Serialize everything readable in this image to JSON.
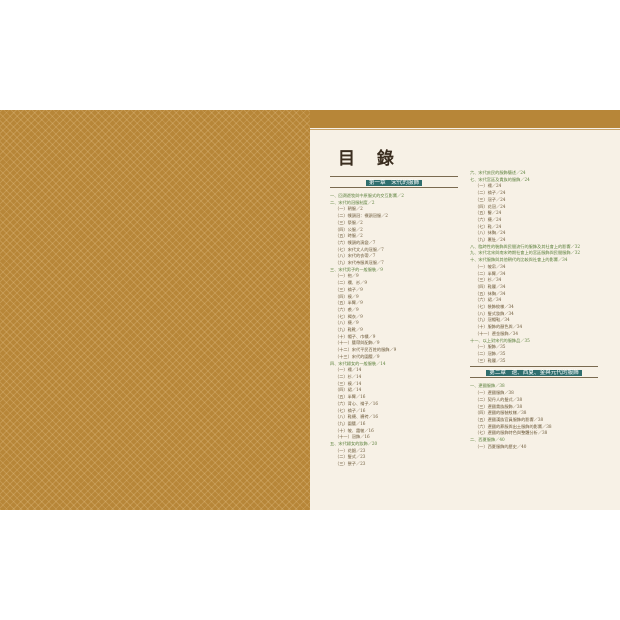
{
  "title": "目 錄",
  "left_column": [
    {
      "type": "chapter",
      "text": "第一章　宋代的服飾"
    },
    {
      "type": "l1",
      "text": "一、回溯遊牧與中原服式的交互影響／2"
    },
    {
      "type": "l1",
      "text": "二、宋代的冠服制度／2"
    },
    {
      "type": "l2",
      "text": "（一）朝服／2"
    },
    {
      "type": "l2",
      "text": "（二）幞頭冠：襆頭冠服／2"
    },
    {
      "type": "l2",
      "text": "（三）祭服／2"
    },
    {
      "type": "l2",
      "text": "（四）公服／2"
    },
    {
      "type": "l2",
      "text": "（五）時服／2"
    },
    {
      "type": "l2",
      "text": "（六）幞頭的演變／7"
    },
    {
      "type": "l2",
      "text": "（七）宋代文人的冠服／7"
    },
    {
      "type": "l2",
      "text": "（八）宋代的衣帶／7"
    },
    {
      "type": "l2",
      "text": "（九）宋代帝服與冠服／7"
    },
    {
      "type": "l1",
      "text": "三、宋代男子的一般服裝／9"
    },
    {
      "type": "l2",
      "text": "（一）袍／9"
    },
    {
      "type": "l2",
      "text": "（二）襴、衫／9"
    },
    {
      "type": "l2",
      "text": "（三）褙子／9"
    },
    {
      "type": "l2",
      "text": "（四）襖／9"
    },
    {
      "type": "l2",
      "text": "（五）半臂／9"
    },
    {
      "type": "l2",
      "text": "（六）裘／9"
    },
    {
      "type": "l2",
      "text": "（七）褐衣／9"
    },
    {
      "type": "l2",
      "text": "（八）襪／9"
    },
    {
      "type": "l2",
      "text": "（九）鞋靴／9"
    },
    {
      "type": "l2",
      "text": "（十）帽子、巾幘／9"
    },
    {
      "type": "l2",
      "text": "（十一）腰帶與配飾／9"
    },
    {
      "type": "l2",
      "text": "（十二）宋代平民百姓的服飾／9"
    },
    {
      "type": "l2",
      "text": "（十三）宋代的圍腰／9"
    },
    {
      "type": "l1",
      "text": "四、宋代婦女的一般服裝／14"
    },
    {
      "type": "l2",
      "text": "（一）襦／14"
    },
    {
      "type": "l2",
      "text": "（二）衫／14"
    },
    {
      "type": "l2",
      "text": "（三）襖／14"
    },
    {
      "type": "l2",
      "text": "（四）裙／14"
    },
    {
      "type": "l2",
      "text": "（五）半臂／16"
    },
    {
      "type": "l2",
      "text": "（六）背心、褙子／16"
    },
    {
      "type": "l2",
      "text": "（七）褙子／16"
    },
    {
      "type": "l2",
      "text": "（八）鞋襪、襪袴／16"
    },
    {
      "type": "l2",
      "text": "（九）圍腰／16"
    },
    {
      "type": "l2",
      "text": "（十）帔、霞帔／16"
    },
    {
      "type": "l2",
      "text": "（十一）冠飾／16"
    },
    {
      "type": "l1",
      "text": "五、宋代婦女的妝飾／20"
    },
    {
      "type": "l2",
      "text": "（一）花鈿／23"
    },
    {
      "type": "l2",
      "text": "（二）髮式／23"
    },
    {
      "type": "l2",
      "text": "（三）鬟子／23"
    }
  ],
  "right_column": [
    {
      "type": "l1",
      "text": "六、宋代庶民的服飾簡述／24"
    },
    {
      "type": "l1",
      "text": "七、宋代宮廷及貴族的服飾／24"
    },
    {
      "type": "l2",
      "text": "（一）襦／24"
    },
    {
      "type": "l2",
      "text": "（二）褙子／24"
    },
    {
      "type": "l2",
      "text": "（三）冠子／24"
    },
    {
      "type": "l2",
      "text": "（四）花冠／24"
    },
    {
      "type": "l2",
      "text": "（五）髻／24"
    },
    {
      "type": "l2",
      "text": "（六）襪／24"
    },
    {
      "type": "l2",
      "text": "（七）鞋／24"
    },
    {
      "type": "l2",
      "text": "（八）抹胸／24"
    },
    {
      "type": "l2",
      "text": "（九）裹肚／24"
    },
    {
      "type": "l1",
      "text": "八、臨時性的裝飾與民間流行的服飾及其社會上的影響／32"
    },
    {
      "type": "l1",
      "text": "九、宋代北宋與南宋時期社會上的宮廷服飾與民間服飾／32"
    },
    {
      "type": "l1",
      "text": "十、宋代服飾與其他朝代的比較與社會上的影響／34"
    },
    {
      "type": "l2",
      "text": "（一）帔帛／34"
    },
    {
      "type": "l2",
      "text": "（二）半臂／34"
    },
    {
      "type": "l2",
      "text": "（三）衫／34"
    },
    {
      "type": "l2",
      "text": "（四）鞋履／34"
    },
    {
      "type": "l2",
      "text": "（五）抹胸／34"
    },
    {
      "type": "l2",
      "text": "（六）裙／34"
    },
    {
      "type": "l2",
      "text": "（七）裝飾紋樣／34"
    },
    {
      "type": "l2",
      "text": "（八）髮式妝飾／34"
    },
    {
      "type": "l2",
      "text": "（九）冠帽鞋／34"
    },
    {
      "type": "l2",
      "text": "（十）服飾的顏色與／34"
    },
    {
      "type": "l2",
      "text": "（十一）遼金服飾／34"
    },
    {
      "type": "l1",
      "text": "十一、以上對宋代的服飾品／35"
    },
    {
      "type": "l2",
      "text": "（一）服飾／35"
    },
    {
      "type": "l2",
      "text": "（二）冠飾／35"
    },
    {
      "type": "l2",
      "text": "（三）鞋履／35"
    },
    {
      "type": "chapter",
      "text": "第二章　遼、西夏、金與元代的服飾"
    },
    {
      "type": "l1",
      "text": "一、遼國服飾／38"
    },
    {
      "type": "l2",
      "text": "（一）遼國服飾／38"
    },
    {
      "type": "l2",
      "text": "（二）契丹人的髮式／38"
    },
    {
      "type": "l2",
      "text": "（三）遼國貴族服飾／38"
    },
    {
      "type": "l2",
      "text": "（四）遼國的服裝紋樣／38"
    },
    {
      "type": "l2",
      "text": "（五）遼國漢族官員服飾的影響／38"
    },
    {
      "type": "l2",
      "text": "（六）遼國的葬服與出土服飾的影響／38"
    },
    {
      "type": "l2",
      "text": "（七）遼國的服飾特色與整體分析／38"
    },
    {
      "type": "l1",
      "text": "二、西夏服飾／40"
    },
    {
      "type": "l2",
      "text": "（一）西夏服飾的歷史／40"
    }
  ]
}
